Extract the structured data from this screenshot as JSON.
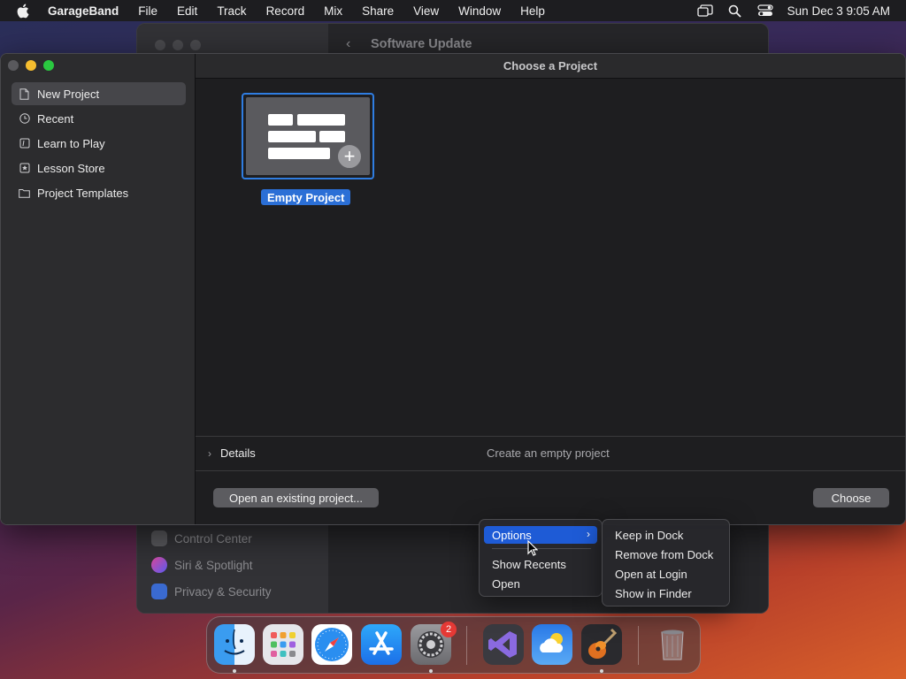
{
  "menubar": {
    "app_name": "GarageBand",
    "menus": [
      "File",
      "Edit",
      "Track",
      "Record",
      "Mix",
      "Share",
      "View",
      "Window",
      "Help"
    ],
    "clock": "Sun Dec 3  9:05 AM"
  },
  "background_window": {
    "title": "Software Update",
    "sidebar_items": [
      {
        "label": "Control Center",
        "color": "#6a6a6e"
      },
      {
        "label": "Siri & Spotlight",
        "color": "#b04ad0"
      },
      {
        "label": "Privacy & Security",
        "color": "#3a6ad0"
      }
    ]
  },
  "gb_window": {
    "title": "Choose a Project",
    "sidebar": [
      {
        "label": "New Project",
        "icon": "document-icon",
        "selected": true
      },
      {
        "label": "Recent",
        "icon": "clock-icon",
        "selected": false
      },
      {
        "label": "Learn to Play",
        "icon": "learn-icon",
        "selected": false
      },
      {
        "label": "Lesson Store",
        "icon": "star-icon",
        "selected": false
      },
      {
        "label": "Project Templates",
        "icon": "folder-icon",
        "selected": false
      }
    ],
    "project": {
      "label": "Empty Project"
    },
    "details": {
      "label": "Details",
      "description": "Create an empty project"
    },
    "open_button": "Open an existing project...",
    "choose_button": "Choose"
  },
  "context_menu": {
    "items": [
      "Options",
      "Show Recents",
      "Open"
    ],
    "submenu": [
      "Keep in Dock",
      "Remove from Dock",
      "Open at Login",
      "Show in Finder"
    ]
  },
  "dock": {
    "apps": [
      {
        "name": "Finder",
        "icon": "finder-icon",
        "running": true
      },
      {
        "name": "Launchpad",
        "icon": "launchpad-icon",
        "running": false
      },
      {
        "name": "Safari",
        "icon": "safari-icon",
        "running": false
      },
      {
        "name": "App Store",
        "icon": "app-store-icon",
        "running": false
      },
      {
        "name": "System Settings",
        "icon": "settings-icon",
        "running": true,
        "badge": "2"
      },
      {
        "name": "Visual Studio",
        "icon": "visual-studio-icon",
        "running": false
      },
      {
        "name": "Weather",
        "icon": "weather-icon",
        "running": false
      },
      {
        "name": "GarageBand",
        "icon": "garageband-icon",
        "running": true
      },
      {
        "name": "Trash",
        "icon": "trash-icon",
        "running": false
      }
    ]
  },
  "colors": {
    "accent": "#2b6fd6",
    "highlight": "#1e5bd6",
    "badge": "#e53935"
  }
}
